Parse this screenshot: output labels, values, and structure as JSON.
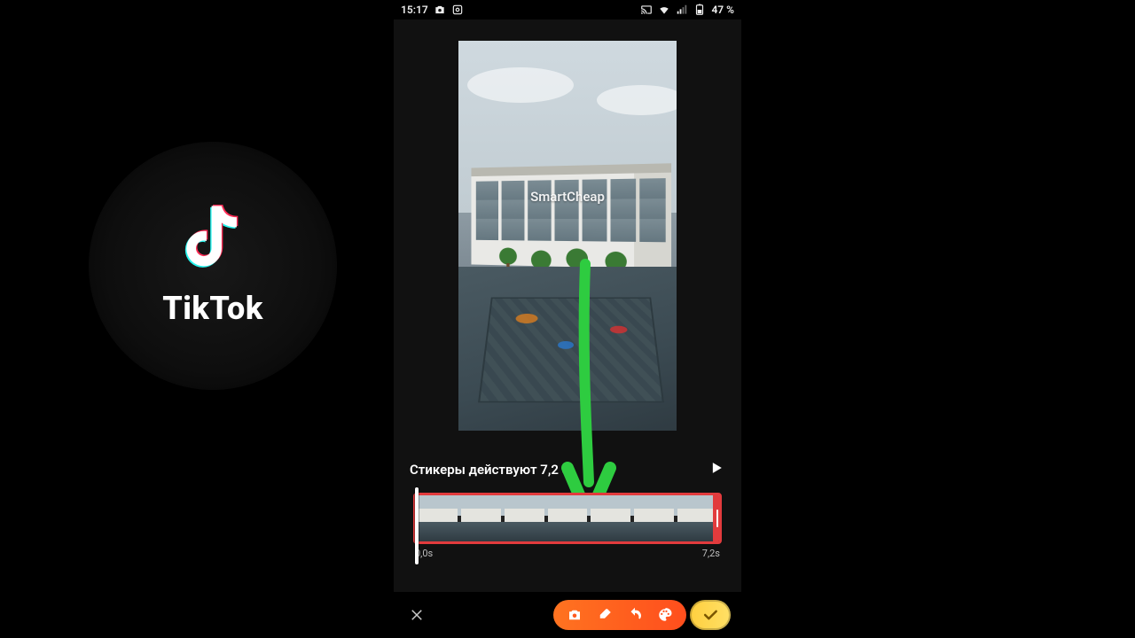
{
  "brand": {
    "label": "TikTok"
  },
  "status": {
    "time": "15:17",
    "battery_pct": "47 %"
  },
  "preview": {
    "watermark": "SmartCheap"
  },
  "sticker": {
    "text": "Стикеры действуют 7,2 с"
  },
  "timeline": {
    "start_label": "0,0s",
    "end_label": "7,2s",
    "duration_s": 7.2,
    "playhead_s": 0.0,
    "thumb_count": 7
  },
  "annotations": {
    "arrow_color": "#2ecc40"
  },
  "colors": {
    "track_border": "#e23b3d",
    "pill_from": "#ff7320",
    "pill_to": "#ff4e1d",
    "confirm_from": "#ffcf3f",
    "confirm_to": "#ffe066"
  }
}
